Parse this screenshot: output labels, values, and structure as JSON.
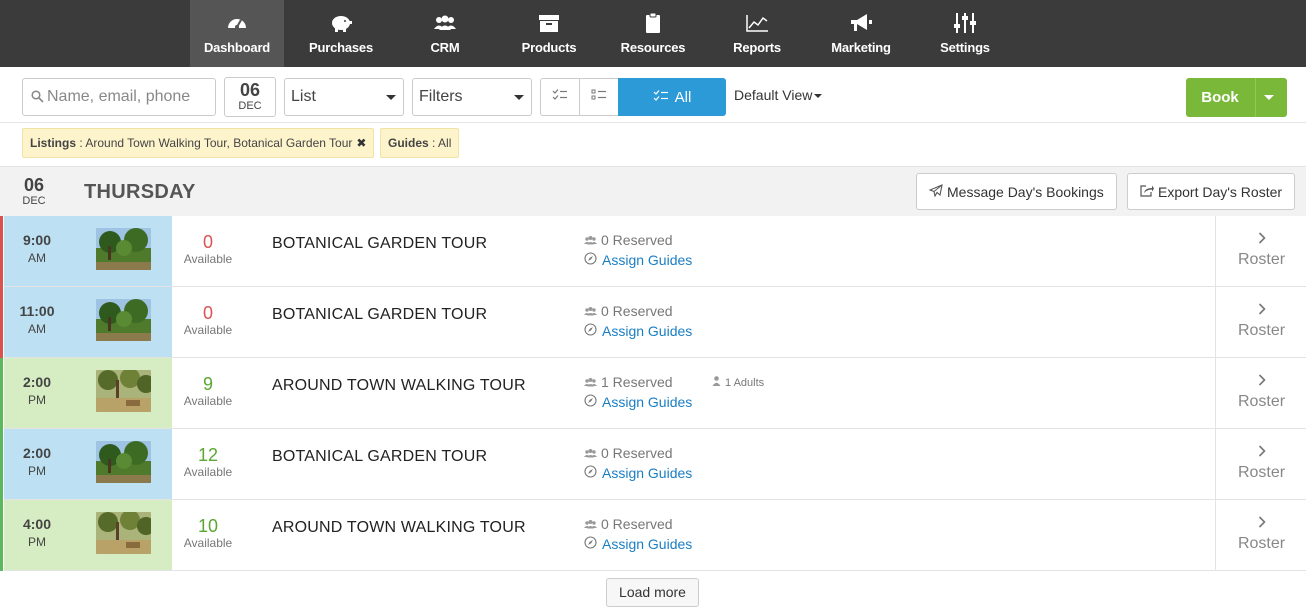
{
  "nav": {
    "items": [
      {
        "label": "Dashboard",
        "icon": "dashboard-gauge-icon",
        "active": true
      },
      {
        "label": "Purchases",
        "icon": "piggy-bank-icon"
      },
      {
        "label": "CRM",
        "icon": "users-icon"
      },
      {
        "label": "Products",
        "icon": "archive-box-icon"
      },
      {
        "label": "Resources",
        "icon": "clipboard-icon"
      },
      {
        "label": "Reports",
        "icon": "line-chart-icon"
      },
      {
        "label": "Marketing",
        "icon": "megaphone-icon"
      },
      {
        "label": "Settings",
        "icon": "sliders-icon"
      }
    ]
  },
  "toolbar": {
    "search_placeholder": "Name, email, phone",
    "date_day": "06",
    "date_month": "DEC",
    "view_select": "List",
    "filters_select": "Filters",
    "segment_all_label": "All",
    "default_view": "Default View",
    "book_label": "Book"
  },
  "filters": {
    "listings_key": "Listings",
    "listings_value": " : Around Town Walking Tour, Botanical Garden Tour",
    "guides_key": "Guides",
    "guides_value": " : All"
  },
  "day": {
    "day": "06",
    "month": "DEC",
    "weekday": "THURSDAY",
    "message_btn": "Message Day's Bookings",
    "export_btn": "Export Day's Roster"
  },
  "rows": [
    {
      "time": "9:00",
      "ampm": "AM",
      "available": "0",
      "available_label": "Available",
      "title": "BOTANICAL GARDEN TOUR",
      "reserved": "0 Reserved",
      "assign": "Assign Guides",
      "adults": "",
      "roster": "Roster",
      "bar_color": "#d9534f",
      "cell_color": "#bde0f3",
      "num_color": "#d9534f"
    },
    {
      "time": "11:00",
      "ampm": "AM",
      "available": "0",
      "available_label": "Available",
      "title": "BOTANICAL GARDEN TOUR",
      "reserved": "0 Reserved",
      "assign": "Assign Guides",
      "adults": "",
      "roster": "Roster",
      "bar_color": "#d9534f",
      "cell_color": "#bde0f3",
      "num_color": "#d9534f"
    },
    {
      "time": "2:00",
      "ampm": "PM",
      "available": "9",
      "available_label": "Available",
      "title": "AROUND TOWN WALKING TOUR",
      "reserved": "1 Reserved",
      "assign": "Assign Guides",
      "adults": "1 Adults",
      "roster": "Roster",
      "bar_color": "#5cb85c",
      "cell_color": "#d6ecc2",
      "num_color": "#5aa832"
    },
    {
      "time": "2:00",
      "ampm": "PM",
      "available": "12",
      "available_label": "Available",
      "title": "BOTANICAL GARDEN TOUR",
      "reserved": "0 Reserved",
      "assign": "Assign Guides",
      "adults": "",
      "roster": "Roster",
      "bar_color": "#5cb85c",
      "cell_color": "#bde0f3",
      "num_color": "#5aa832"
    },
    {
      "time": "4:00",
      "ampm": "PM",
      "available": "10",
      "available_label": "Available",
      "title": "AROUND TOWN WALKING TOUR",
      "reserved": "0 Reserved",
      "assign": "Assign Guides",
      "adults": "",
      "roster": "Roster",
      "bar_color": "#5cb85c",
      "cell_color": "#d6ecc2",
      "num_color": "#5aa832"
    }
  ],
  "load_more": "Load more",
  "colors": {
    "accent": "#2d9ad8",
    "book": "#7ab83a",
    "link": "#1a7ec3"
  }
}
